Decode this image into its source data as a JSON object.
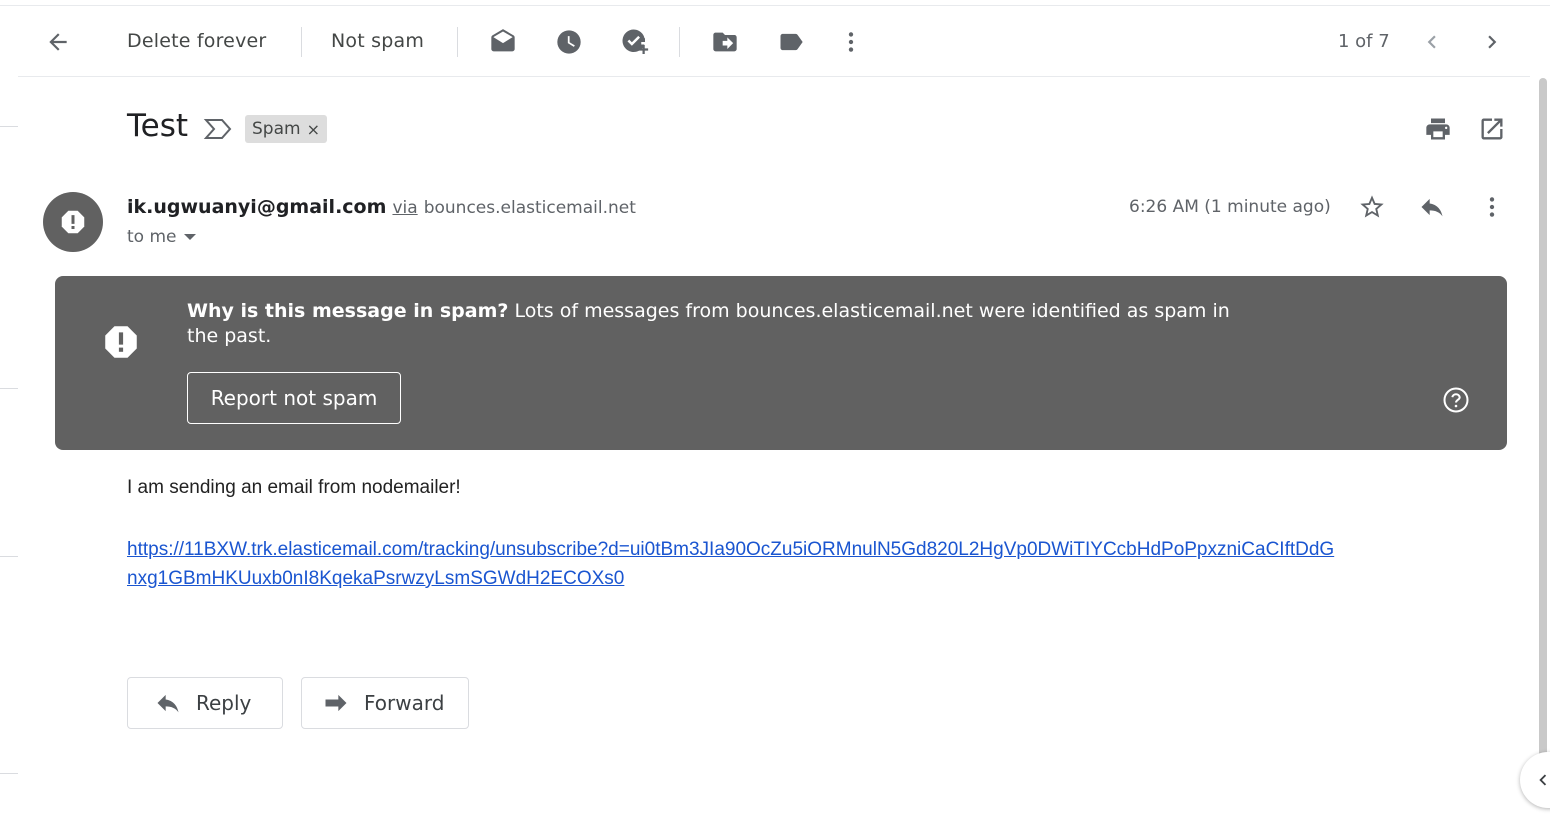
{
  "toolbar": {
    "delete_forever": "Delete forever",
    "not_spam": "Not spam",
    "pagination": "1 of 7",
    "icons": [
      "back-arrow-icon",
      "mark-unread-icon",
      "snooze-clock-icon",
      "add-task-icon",
      "move-to-icon",
      "label-icon",
      "more-vert-icon",
      "chevron-left-icon",
      "chevron-right-icon"
    ]
  },
  "message": {
    "subject": "Test",
    "label_chip": "Spam",
    "label_chip_remove": "×",
    "sender_email": "ik.ugwuanyi@gmail.com",
    "via_label": "via",
    "via_domain": "bounces.elasticemail.net",
    "recipient": "to me",
    "timestamp": "6:26 AM (1 minute ago)"
  },
  "spam_banner": {
    "heading": "Why is this message in spam?",
    "explanation": "Lots of messages from bounces.elasticemail.net were identified as spam in the past.",
    "report_button": "Report not spam",
    "bg_color": "#616161"
  },
  "body": {
    "text": "I am sending an email from nodemailer!",
    "link": "https://11BXW.trk.elasticemail.com/tracking/unsubscribe?d=ui0tBm3JIa90OcZu5iORMnulN5Gd820L2HgVp0DWiTIYCcbHdPoPpxzniCaCIftDdGnxg1GBmHKUuxb0nI8KqekaPsrwzyLsmSGWdH2ECOXs0",
    "link_color": "#1a55d0"
  },
  "actions": {
    "reply": "Reply",
    "forward": "Forward"
  }
}
